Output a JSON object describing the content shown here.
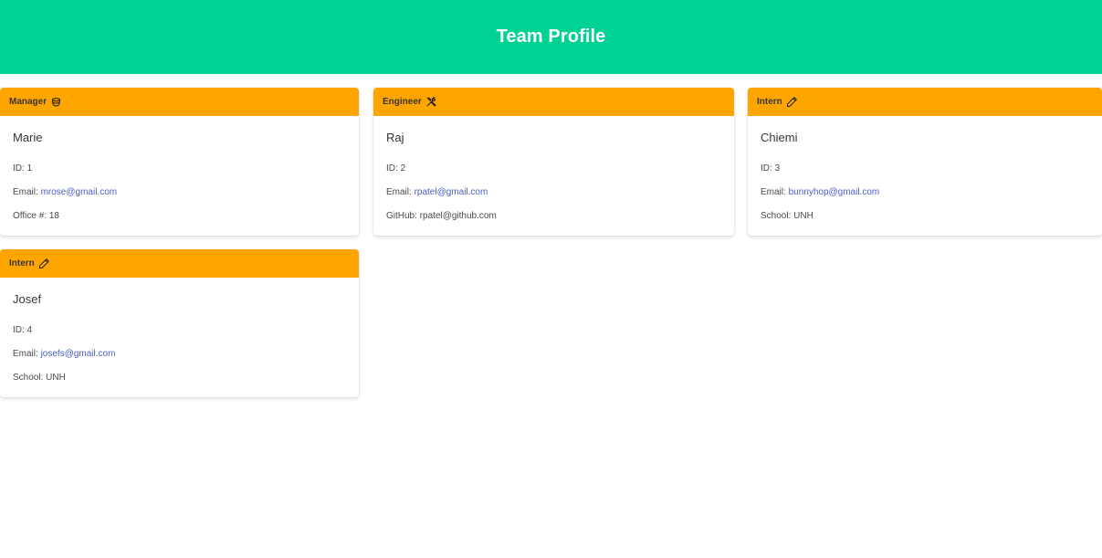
{
  "colors": {
    "hero": "#00d293",
    "card_header": "#ffa500",
    "link": "#485fc7"
  },
  "page": {
    "title": "Team Profile"
  },
  "cards": [
    {
      "role": "Manager",
      "icon": "coffee-cup-icon",
      "name": "Marie",
      "id_label": "ID:",
      "id": "1",
      "email_label": "Email:",
      "email": "mrose@gmail.com",
      "extra_label": "Office #:",
      "extra": "18"
    },
    {
      "role": "Engineer",
      "icon": "tools-icon",
      "name": "Raj",
      "id_label": "ID:",
      "id": "2",
      "email_label": "Email:",
      "email": "rpatel@gmail.com",
      "extra_label": "GitHub:",
      "extra": "rpatel@github.com"
    },
    {
      "role": "Intern",
      "icon": "pencil-icon",
      "name": "Chiemi",
      "id_label": "ID:",
      "id": "3",
      "email_label": "Email:",
      "email": "bunnyhop@gmail.com",
      "extra_label": "School:",
      "extra": "UNH"
    },
    {
      "role": "Intern",
      "icon": "pencil-icon",
      "name": "Josef",
      "id_label": "ID:",
      "id": "4",
      "email_label": "Email:",
      "email": "josefs@gmail.com",
      "extra_label": "School:",
      "extra": "UNH"
    }
  ]
}
